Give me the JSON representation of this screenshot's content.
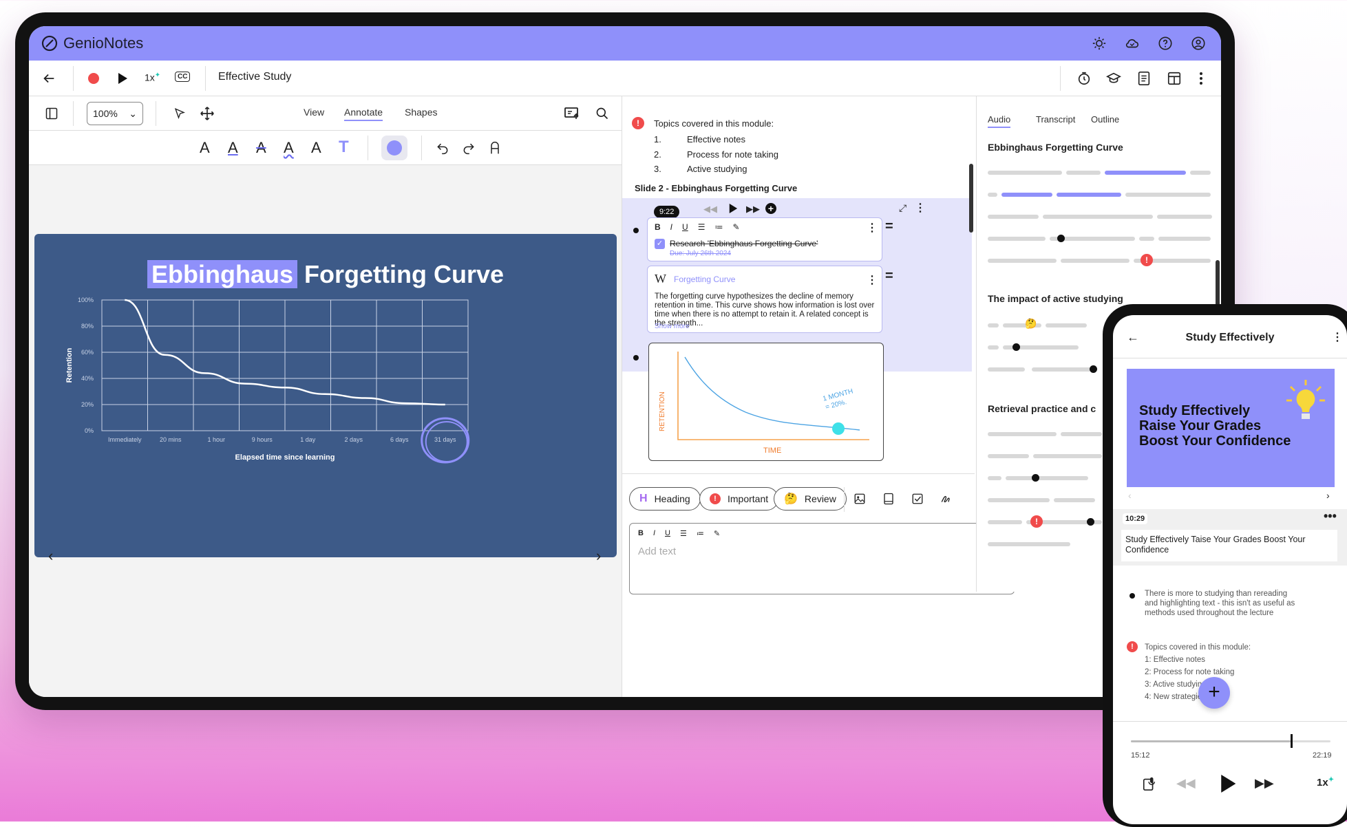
{
  "app": {
    "brand_prefix": "Genio",
    "brand_suffix": "Notes",
    "doc_title": "Effective Study",
    "speed": "1x",
    "cc": "CC"
  },
  "left": {
    "zoom": "100%",
    "tabs": [
      "View",
      "Annotate",
      "Shapes"
    ],
    "slide": {
      "title_highlight": "Ebbinghaus",
      "title_rest": " Forgetting Curve",
      "chart_data": {
        "type": "line",
        "categories": [
          "Immediately",
          "20 mins",
          "1 hour",
          "9 hours",
          "1 day",
          "2 days",
          "6 days",
          "31 days"
        ],
        "y_ticks": [
          "100%",
          "80%",
          "60%",
          "40%",
          "20%",
          "0%"
        ],
        "ylabel": "Retention",
        "xlabel": "Elapsed time since learning",
        "ylim": [
          0,
          100
        ],
        "grid": true,
        "series": [
          {
            "values": [
              100,
              58,
              44,
              36,
              33,
              28,
              25,
              21,
              20
            ]
          }
        ]
      }
    }
  },
  "middle": {
    "topics_heading": "Topics covered in this module:",
    "topics": [
      {
        "n": "1.",
        "t": "Effective notes"
      },
      {
        "n": "2.",
        "t": "Process for note taking"
      },
      {
        "n": "3.",
        "t": "Active studying"
      }
    ],
    "slide_label": "Slide 2 - Ebbinghaus Forgetting Curve",
    "time": "9:22",
    "task": "Research 'Ebbinghaus Forgetting Curve'",
    "task_due": "Due: July 26th 2024",
    "wiki_title": "Forgetting Curve",
    "wiki_body": "The forgetting curve hypothesizes the decline of memory retention in time. This curve shows how information is lost over time when there is no attempt to retain it. A related concept is the strength...",
    "show_more": "Show more",
    "sketch": {
      "ylabel": "RETENTION",
      "xlabel": "TIME",
      "note1": "1 MONTH",
      "note2": "= 20%."
    },
    "pills": [
      "Heading",
      "Important",
      "Review"
    ],
    "add_text_placeholder": "Add text"
  },
  "right": {
    "tabs": [
      "Audio",
      "Transcript",
      "Outline"
    ],
    "sections": [
      "Ebbinghaus Forgetting Curve",
      "The impact of active studying",
      "Retrieval practice and c"
    ]
  },
  "phone": {
    "title": "Study Effectively",
    "hero_lines": [
      "Study Effectively",
      "Raise Your Grades",
      "Boost Your Confidence"
    ],
    "time": "10:29",
    "card_title": "Study Effectively Taise Your Grades Boost Your Confidence",
    "note1": "There is more to studying than rereading and highlighting text - this isn't as useful as methods used throughout the lecture",
    "topics_heading": "Topics covered in this module:",
    "topics": [
      "1: Effective notes",
      "2: Process for note taking",
      "3: Active studying",
      "4: New strategies"
    ],
    "progress": 0.8,
    "elapsed": "15:12",
    "total": "22:19",
    "speed": "1x"
  },
  "colors": {
    "accent": "#8f90fa",
    "slide_bg": "#3d5a88",
    "record": "#f04b4b"
  }
}
